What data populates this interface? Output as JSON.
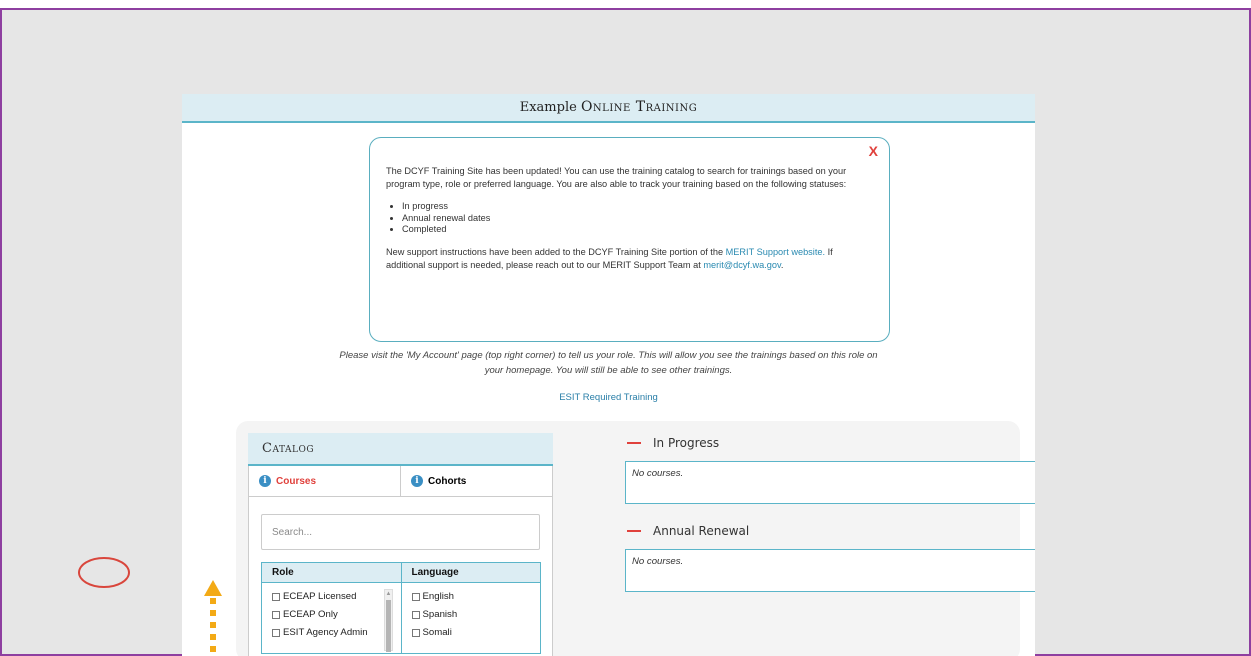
{
  "header": {
    "prefix": "Example",
    "title": "Online Training"
  },
  "notice": {
    "close_label": "X",
    "paragraph1": "The DCYF Training Site has been updated! You can use the training catalog to search for trainings based on your program type, role or preferred language. You are also able to track your training based on the following statuses:",
    "statuses": [
      "In progress",
      "Annual renewal dates",
      "Completed"
    ],
    "p2_before": "New support instructions have been added to the DCYF Training Site portion of the ",
    "p2_link": "MERIT Support website.",
    "p2_after": " If additional support is needed, please reach out to our MERIT Support Team at ",
    "email": "merit@dcyf.wa.gov",
    "email_suffix": "."
  },
  "instruction": "Please visit the 'My Account' page (top right corner) to tell us your role. This will allow you see the trainings based on this role on your homepage. You will still be able to see other trainings.",
  "esit_link": "ESIT Required Training",
  "catalog": {
    "title": "Catalog",
    "tabs": [
      {
        "label": "Courses",
        "active": true
      },
      {
        "label": "Cohorts",
        "active": false
      }
    ],
    "search_placeholder": "Search...",
    "filter_headers": [
      "Role",
      "Language"
    ],
    "roles": [
      "ECEAP Licensed",
      "ECEAP Only",
      "ESIT Agency Admin"
    ],
    "languages": [
      "English",
      "Spanish",
      "Somali"
    ]
  },
  "status": {
    "in_progress": {
      "title": "In Progress",
      "empty": "No courses."
    },
    "annual_renewal": {
      "title": "Annual Renewal",
      "empty": "No courses."
    }
  },
  "colors": {
    "accent": "#5bb5c9",
    "alert": "#e0413c",
    "link": "#2a8ab1",
    "annotation_arrow": "#f3aa16",
    "frame_border": "#8e3fa0"
  }
}
